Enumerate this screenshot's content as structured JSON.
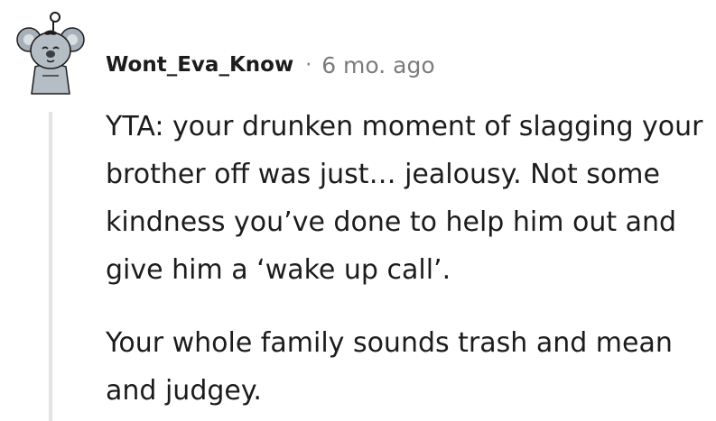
{
  "comment": {
    "author": "Wont_Eva_Know",
    "separator": "·",
    "time": "6 mo. ago",
    "avatar_icon": "koala-avatar-icon",
    "paragraphs": [
      "YTA: your drunken moment of slagging your brother off was just… jealousy. Not some kindness you’ve done to help him out and give him a ‘wake up call’.",
      "Your whole family sounds trash and mean and judgey."
    ]
  },
  "colors": {
    "text": "#1c1c1c",
    "meta": "#7c7c7c",
    "thread_line": "#e4e4e4",
    "avatar_gray": "#9aa4ae"
  }
}
